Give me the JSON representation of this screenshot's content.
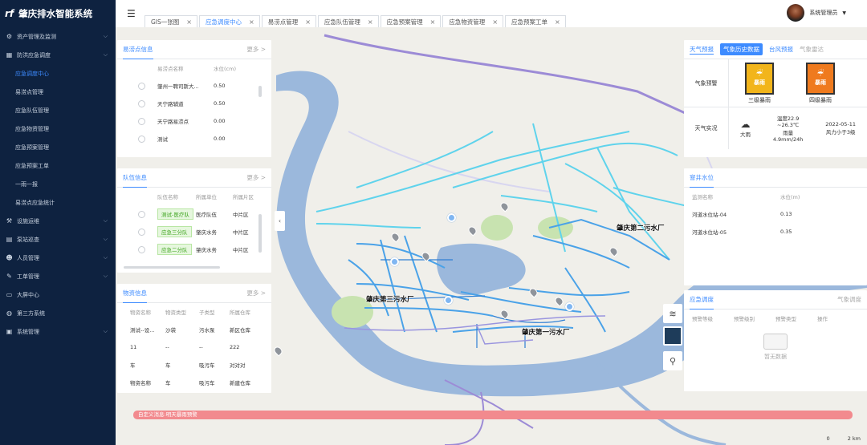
{
  "app": {
    "title": "肇庆排水智能系统"
  },
  "sidebar": {
    "items": [
      {
        "label": "资产管理及监测",
        "icon": "gear-icon",
        "expand": true
      },
      {
        "label": "防洪应急调度",
        "icon": "grid-icon",
        "expand": true
      },
      {
        "label": "应急调度中心",
        "sub": true,
        "active": true
      },
      {
        "label": "易涝点管理",
        "sub": true
      },
      {
        "label": "应急队伍管理",
        "sub": true
      },
      {
        "label": "应急物资管理",
        "sub": true
      },
      {
        "label": "应急预案管理",
        "sub": true
      },
      {
        "label": "应急预案工单",
        "sub": true
      },
      {
        "label": "一雨一报",
        "sub": true
      },
      {
        "label": "易涝点应急统计",
        "sub": true
      },
      {
        "label": "设施运维",
        "icon": "tool-icon",
        "expand": true
      },
      {
        "label": "泵站巡查",
        "icon": "chart-icon",
        "expand": true
      },
      {
        "label": "人员管理",
        "icon": "people-icon",
        "expand": true
      },
      {
        "label": "工单管理",
        "icon": "edit-icon",
        "expand": true
      },
      {
        "label": "大屏中心",
        "icon": "screen-icon",
        "expand": false
      },
      {
        "label": "第三方系统",
        "icon": "globe-icon",
        "expand": false
      },
      {
        "label": "系统管理",
        "icon": "monitor-icon",
        "expand": true
      }
    ]
  },
  "tabs": [
    {
      "label": "GIS一张图",
      "active": false
    },
    {
      "label": "应急调度中心",
      "active": true
    },
    {
      "label": "易涝点管理",
      "active": false
    },
    {
      "label": "应急队伍管理",
      "active": false
    },
    {
      "label": "应急预案管理",
      "active": false
    },
    {
      "label": "应急物资管理",
      "active": false
    },
    {
      "label": "应急预案工单",
      "active": false
    }
  ],
  "user": {
    "name": "系统管理员"
  },
  "waterlog": {
    "title": "易涝点信息",
    "more": "更多 >",
    "headers": [
      "",
      "易涝点名称",
      "水位(cm)"
    ],
    "rows": [
      [
        "肇州一聘司斯大...",
        "0.50"
      ],
      [
        "天宁路辅道",
        "0.50"
      ],
      [
        "天宁路易涝点",
        "0.00"
      ],
      [
        "测试",
        "0.00"
      ]
    ]
  },
  "team": {
    "title": "队伍信息",
    "more": "更多 >",
    "headers": [
      "",
      "队伍名称",
      "所属单位",
      "所属片区"
    ],
    "rows": [
      [
        "测试-医疗队",
        "医疗队伍",
        "中片区"
      ],
      [
        "应急三分队",
        "肇庆水务",
        "中片区"
      ],
      [
        "应急二分队",
        "肇庆水务",
        "中片区"
      ]
    ]
  },
  "material": {
    "title": "物资信息",
    "more": "更多 >",
    "headers": [
      "物资名称",
      "物资类型",
      "子类型",
      "所属仓库"
    ],
    "rows": [
      [
        "测试--设...",
        "沙袋",
        "污水泵",
        "新区仓库"
      ],
      [
        "11",
        "--",
        "--",
        "222"
      ],
      [
        "车",
        "车",
        "吸污车",
        "对对对"
      ],
      [
        "物资名称",
        "车",
        "吸污车",
        "新建仓库"
      ]
    ]
  },
  "weather": {
    "tabs": [
      "天气预报",
      "气象历史数据",
      "台风预报",
      "气象雷达"
    ],
    "active_tab": 1,
    "warn_label": "气象预警",
    "obs_label": "天气实况",
    "warnings": [
      {
        "name": "三级暴雨",
        "badge": "暴雨",
        "color": "#f2b51b"
      },
      {
        "name": "四级暴雨",
        "badge": "暴雨",
        "color": "#ef7a1e"
      }
    ],
    "icon_label": "大雨",
    "temp": "温度22.9",
    "temp_range": "~26.3℃",
    "rain": "雨量",
    "rain_val": "4.9mm/24h",
    "date": "2022-05-11",
    "wind": "风力小于3级"
  },
  "well": {
    "title": "窨井水位",
    "headers": [
      "监测名称",
      "水位(m)"
    ],
    "rows": [
      [
        "河道水位站-04",
        "0.13"
      ],
      [
        "河道水位站-05",
        "0.35"
      ]
    ]
  },
  "dispatch": {
    "title": "应急调度",
    "right": "气象调度",
    "headers": [
      "预警等级",
      "预警级别",
      "预警类型",
      "操作"
    ],
    "empty": "暂无数据"
  },
  "map": {
    "labels": [
      "肇庆第二污水厂",
      "肇庆第三污水厂",
      "肇庆第一污水厂"
    ]
  },
  "alert": {
    "text": "自定义消息:明天暴雨预警"
  },
  "scale": {
    "left": "0",
    "right": "2 km"
  }
}
